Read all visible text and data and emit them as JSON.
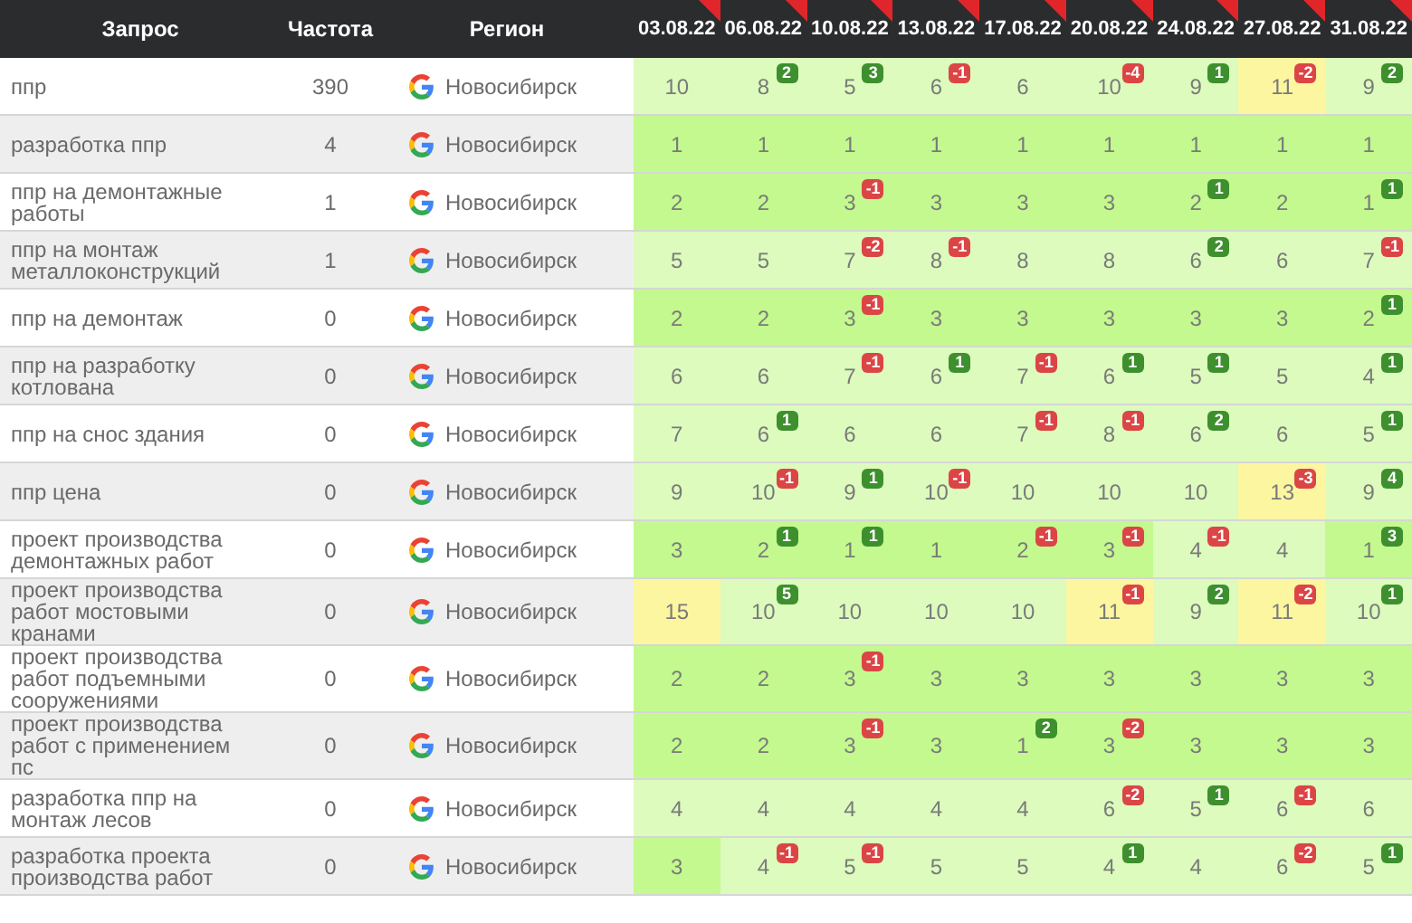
{
  "table": {
    "columns": [
      {
        "label": "Запрос",
        "kind": "query"
      },
      {
        "label": "Частота",
        "kind": "frequency"
      },
      {
        "label": "Регион",
        "kind": "region"
      },
      {
        "label": "03.08.22",
        "kind": "date",
        "flagged": true
      },
      {
        "label": "06.08.22",
        "kind": "date",
        "flagged": true
      },
      {
        "label": "10.08.22",
        "kind": "date",
        "flagged": true
      },
      {
        "label": "13.08.22",
        "kind": "date",
        "flagged": true
      },
      {
        "label": "17.08.22",
        "kind": "date",
        "flagged": true
      },
      {
        "label": "20.08.22",
        "kind": "date",
        "flagged": true
      },
      {
        "label": "24.08.22",
        "kind": "date",
        "flagged": true
      },
      {
        "label": "27.08.22",
        "kind": "date",
        "flagged": true
      },
      {
        "label": "31.08.22",
        "kind": "date",
        "flagged": true
      }
    ],
    "rows": [
      {
        "query": "ппр",
        "frequency": "390",
        "region": "Новосибирск",
        "positions": [
          {
            "value": "10",
            "color": "#dcfbbd"
          },
          {
            "value": "8",
            "color": "#dcfbbd",
            "change": "2",
            "up": true
          },
          {
            "value": "5",
            "color": "#dcfbbd",
            "change": "3",
            "up": true
          },
          {
            "value": "6",
            "color": "#dcfbbd",
            "change": "-1",
            "up": false
          },
          {
            "value": "6",
            "color": "#dcfbbd"
          },
          {
            "value": "10",
            "color": "#dcfbbd",
            "change": "-4",
            "up": false
          },
          {
            "value": "9",
            "color": "#dcfbbd",
            "change": "1",
            "up": true
          },
          {
            "value": "11",
            "color": "#fdf6a1",
            "change": "-2",
            "up": false
          },
          {
            "value": "9",
            "color": "#dcfbbd",
            "change": "2",
            "up": true
          }
        ]
      },
      {
        "query": "разработка ппр",
        "frequency": "4",
        "region": "Новосибирск",
        "positions": [
          {
            "value": "1",
            "color": "#c3f98e"
          },
          {
            "value": "1",
            "color": "#c3f98e"
          },
          {
            "value": "1",
            "color": "#c3f98e"
          },
          {
            "value": "1",
            "color": "#c3f98e"
          },
          {
            "value": "1",
            "color": "#c3f98e"
          },
          {
            "value": "1",
            "color": "#c3f98e"
          },
          {
            "value": "1",
            "color": "#c3f98e"
          },
          {
            "value": "1",
            "color": "#c3f98e"
          },
          {
            "value": "1",
            "color": "#c3f98e"
          }
        ]
      },
      {
        "query": "ппр на демонтажные работы",
        "frequency": "1",
        "region": "Новосибирск",
        "positions": [
          {
            "value": "2",
            "color": "#c3f98e"
          },
          {
            "value": "2",
            "color": "#c3f98e"
          },
          {
            "value": "3",
            "color": "#c3f98e",
            "change": "-1",
            "up": false
          },
          {
            "value": "3",
            "color": "#c3f98e"
          },
          {
            "value": "3",
            "color": "#c3f98e"
          },
          {
            "value": "3",
            "color": "#c3f98e"
          },
          {
            "value": "2",
            "color": "#c3f98e",
            "change": "1",
            "up": true
          },
          {
            "value": "2",
            "color": "#c3f98e"
          },
          {
            "value": "1",
            "color": "#c3f98e",
            "change": "1",
            "up": true
          }
        ]
      },
      {
        "query": "ппр на монтаж металлоконструкций",
        "frequency": "1",
        "region": "Новосибирск",
        "positions": [
          {
            "value": "5",
            "color": "#dcfbbd"
          },
          {
            "value": "5",
            "color": "#dcfbbd"
          },
          {
            "value": "7",
            "color": "#dcfbbd",
            "change": "-2",
            "up": false
          },
          {
            "value": "8",
            "color": "#dcfbbd",
            "change": "-1",
            "up": false
          },
          {
            "value": "8",
            "color": "#dcfbbd"
          },
          {
            "value": "8",
            "color": "#dcfbbd"
          },
          {
            "value": "6",
            "color": "#dcfbbd",
            "change": "2",
            "up": true
          },
          {
            "value": "6",
            "color": "#dcfbbd"
          },
          {
            "value": "7",
            "color": "#dcfbbd",
            "change": "-1",
            "up": false
          }
        ]
      },
      {
        "query": "ппр на демонтаж",
        "frequency": "0",
        "region": "Новосибирск",
        "positions": [
          {
            "value": "2",
            "color": "#c3f98e"
          },
          {
            "value": "2",
            "color": "#c3f98e"
          },
          {
            "value": "3",
            "color": "#c3f98e",
            "change": "-1",
            "up": false
          },
          {
            "value": "3",
            "color": "#c3f98e"
          },
          {
            "value": "3",
            "color": "#c3f98e"
          },
          {
            "value": "3",
            "color": "#c3f98e"
          },
          {
            "value": "3",
            "color": "#c3f98e"
          },
          {
            "value": "3",
            "color": "#c3f98e"
          },
          {
            "value": "2",
            "color": "#c3f98e",
            "change": "1",
            "up": true
          }
        ]
      },
      {
        "query": "ппр на разработку котлована",
        "frequency": "0",
        "region": "Новосибирск",
        "positions": [
          {
            "value": "6",
            "color": "#dcfbbd"
          },
          {
            "value": "6",
            "color": "#dcfbbd"
          },
          {
            "value": "7",
            "color": "#dcfbbd",
            "change": "-1",
            "up": false
          },
          {
            "value": "6",
            "color": "#dcfbbd",
            "change": "1",
            "up": true
          },
          {
            "value": "7",
            "color": "#dcfbbd",
            "change": "-1",
            "up": false
          },
          {
            "value": "6",
            "color": "#dcfbbd",
            "change": "1",
            "up": true
          },
          {
            "value": "5",
            "color": "#dcfbbd",
            "change": "1",
            "up": true
          },
          {
            "value": "5",
            "color": "#dcfbbd"
          },
          {
            "value": "4",
            "color": "#dcfbbd",
            "change": "1",
            "up": true
          }
        ]
      },
      {
        "query": "ппр на снос здания",
        "frequency": "0",
        "region": "Новосибирск",
        "positions": [
          {
            "value": "7",
            "color": "#dcfbbd"
          },
          {
            "value": "6",
            "color": "#dcfbbd",
            "change": "1",
            "up": true
          },
          {
            "value": "6",
            "color": "#dcfbbd"
          },
          {
            "value": "6",
            "color": "#dcfbbd"
          },
          {
            "value": "7",
            "color": "#dcfbbd",
            "change": "-1",
            "up": false
          },
          {
            "value": "8",
            "color": "#dcfbbd",
            "change": "-1",
            "up": false
          },
          {
            "value": "6",
            "color": "#dcfbbd",
            "change": "2",
            "up": true
          },
          {
            "value": "6",
            "color": "#dcfbbd"
          },
          {
            "value": "5",
            "color": "#dcfbbd",
            "change": "1",
            "up": true
          }
        ]
      },
      {
        "query": "ппр цена",
        "frequency": "0",
        "region": "Новосибирск",
        "positions": [
          {
            "value": "9",
            "color": "#dcfbbd"
          },
          {
            "value": "10",
            "color": "#dcfbbd",
            "change": "-1",
            "up": false
          },
          {
            "value": "9",
            "color": "#dcfbbd",
            "change": "1",
            "up": true
          },
          {
            "value": "10",
            "color": "#dcfbbd",
            "change": "-1",
            "up": false
          },
          {
            "value": "10",
            "color": "#dcfbbd"
          },
          {
            "value": "10",
            "color": "#dcfbbd"
          },
          {
            "value": "10",
            "color": "#dcfbbd"
          },
          {
            "value": "13",
            "color": "#fdf6a1",
            "change": "-3",
            "up": false
          },
          {
            "value": "9",
            "color": "#dcfbbd",
            "change": "4",
            "up": true
          }
        ]
      },
      {
        "query": "проект производства демонтажных работ",
        "frequency": "0",
        "region": "Новосибирск",
        "positions": [
          {
            "value": "3",
            "color": "#c3f98e"
          },
          {
            "value": "2",
            "color": "#c3f98e",
            "change": "1",
            "up": true
          },
          {
            "value": "1",
            "color": "#c3f98e",
            "change": "1",
            "up": true
          },
          {
            "value": "1",
            "color": "#c3f98e"
          },
          {
            "value": "2",
            "color": "#c3f98e",
            "change": "-1",
            "up": false
          },
          {
            "value": "3",
            "color": "#c3f98e",
            "change": "-1",
            "up": false
          },
          {
            "value": "4",
            "color": "#dcfbbd",
            "change": "-1",
            "up": false
          },
          {
            "value": "4",
            "color": "#dcfbbd"
          },
          {
            "value": "1",
            "color": "#c3f98e",
            "change": "3",
            "up": true
          }
        ]
      },
      {
        "query": "проект производства работ мостовыми кранами",
        "frequency": "0",
        "region": "Новосибирск",
        "positions": [
          {
            "value": "15",
            "color": "#fdf6a1"
          },
          {
            "value": "10",
            "color": "#dcfbbd",
            "change": "5",
            "up": true
          },
          {
            "value": "10",
            "color": "#dcfbbd"
          },
          {
            "value": "10",
            "color": "#dcfbbd"
          },
          {
            "value": "10",
            "color": "#dcfbbd"
          },
          {
            "value": "11",
            "color": "#fdf6a1",
            "change": "-1",
            "up": false
          },
          {
            "value": "9",
            "color": "#dcfbbd",
            "change": "2",
            "up": true
          },
          {
            "value": "11",
            "color": "#fdf6a1",
            "change": "-2",
            "up": false
          },
          {
            "value": "10",
            "color": "#dcfbbd",
            "change": "1",
            "up": true
          }
        ]
      },
      {
        "query": "проект производства работ подъемными сооружениями",
        "frequency": "0",
        "region": "Новосибирск",
        "positions": [
          {
            "value": "2",
            "color": "#c3f98e"
          },
          {
            "value": "2",
            "color": "#c3f98e"
          },
          {
            "value": "3",
            "color": "#c3f98e",
            "change": "-1",
            "up": false
          },
          {
            "value": "3",
            "color": "#c3f98e"
          },
          {
            "value": "3",
            "color": "#c3f98e"
          },
          {
            "value": "3",
            "color": "#c3f98e"
          },
          {
            "value": "3",
            "color": "#c3f98e"
          },
          {
            "value": "3",
            "color": "#c3f98e"
          },
          {
            "value": "3",
            "color": "#c3f98e"
          }
        ]
      },
      {
        "query": "проект производства работ с применением пс",
        "frequency": "0",
        "region": "Новосибирск",
        "positions": [
          {
            "value": "2",
            "color": "#c3f98e"
          },
          {
            "value": "2",
            "color": "#c3f98e"
          },
          {
            "value": "3",
            "color": "#c3f98e",
            "change": "-1",
            "up": false
          },
          {
            "value": "3",
            "color": "#c3f98e"
          },
          {
            "value": "1",
            "color": "#c3f98e",
            "change": "2",
            "up": true
          },
          {
            "value": "3",
            "color": "#c3f98e",
            "change": "-2",
            "up": false
          },
          {
            "value": "3",
            "color": "#c3f98e"
          },
          {
            "value": "3",
            "color": "#c3f98e"
          },
          {
            "value": "3",
            "color": "#c3f98e"
          }
        ]
      },
      {
        "query": "разработка ппр на монтаж лесов",
        "frequency": "0",
        "region": "Новосибирск",
        "positions": [
          {
            "value": "4",
            "color": "#dcfbbd"
          },
          {
            "value": "4",
            "color": "#dcfbbd"
          },
          {
            "value": "4",
            "color": "#dcfbbd"
          },
          {
            "value": "4",
            "color": "#dcfbbd"
          },
          {
            "value": "4",
            "color": "#dcfbbd"
          },
          {
            "value": "6",
            "color": "#dcfbbd",
            "change": "-2",
            "up": false
          },
          {
            "value": "5",
            "color": "#dcfbbd",
            "change": "1",
            "up": true
          },
          {
            "value": "6",
            "color": "#dcfbbd",
            "change": "-1",
            "up": false
          },
          {
            "value": "6",
            "color": "#dcfbbd"
          }
        ]
      },
      {
        "query": "разработка проекта производства работ",
        "frequency": "0",
        "region": "Новосибирск",
        "positions": [
          {
            "value": "3",
            "color": "#c3f98e"
          },
          {
            "value": "4",
            "color": "#dcfbbd",
            "change": "-1",
            "up": false
          },
          {
            "value": "5",
            "color": "#dcfbbd",
            "change": "-1",
            "up": false
          },
          {
            "value": "5",
            "color": "#dcfbbd"
          },
          {
            "value": "5",
            "color": "#dcfbbd"
          },
          {
            "value": "4",
            "color": "#dcfbbd",
            "change": "1",
            "up": true
          },
          {
            "value": "4",
            "color": "#dcfbbd"
          },
          {
            "value": "6",
            "color": "#dcfbbd",
            "change": "-2",
            "up": false
          },
          {
            "value": "5",
            "color": "#dcfbbd",
            "change": "1",
            "up": true
          }
        ]
      }
    ]
  }
}
